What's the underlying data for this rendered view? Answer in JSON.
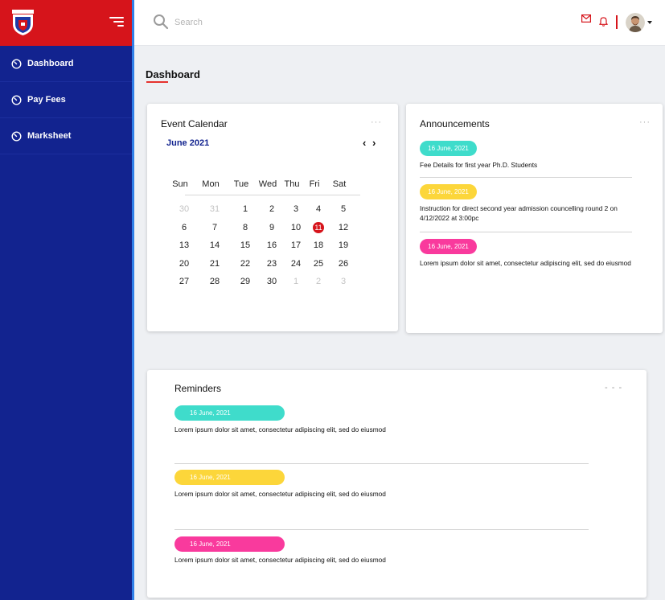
{
  "sidebar": {
    "items": [
      {
        "label": "Dashboard"
      },
      {
        "label": "Pay Fees"
      },
      {
        "label": "Marksheet"
      }
    ]
  },
  "topbar": {
    "search_placeholder": "Search"
  },
  "page": {
    "title": "Dashboard"
  },
  "calendar": {
    "title": "Event Calendar",
    "month_label": "June 2021",
    "prev": "‹",
    "next": "›",
    "weekdays": [
      "Sun",
      "Mon",
      "Tue",
      "Wed",
      "Thu",
      "Fri",
      "Sat"
    ],
    "weeks": [
      [
        "30",
        "31",
        "1",
        "2",
        "3",
        "4",
        "5"
      ],
      [
        "6",
        "7",
        "8",
        "9",
        "10",
        "11",
        "12"
      ],
      [
        "13",
        "14",
        "15",
        "16",
        "17",
        "18",
        "19"
      ],
      [
        "20",
        "21",
        "22",
        "23",
        "24",
        "25",
        "26"
      ],
      [
        "27",
        "28",
        "29",
        "30",
        "1",
        "2",
        "3"
      ]
    ],
    "selected_day": "11",
    "menu": "···"
  },
  "announcements": {
    "title": "Announcements",
    "menu": "···",
    "items": [
      {
        "date": "16 June, 2021",
        "text": "Fee Details for first year Ph.D. Students",
        "color": "#3fdccb"
      },
      {
        "date": "16 June, 2021",
        "text": "Instruction for direct second year admission councelling round 2 on 4/12/2022 at 3:00pc",
        "color": "#fcd63a"
      },
      {
        "date": "16 June, 2021",
        "text": "Lorem ipsum dolor sit amet, consectetur adipiscing elit, sed do eiusmod",
        "color": "#f93a9d"
      }
    ]
  },
  "reminders": {
    "title": "Reminders",
    "menu": "- - -",
    "items": [
      {
        "date": "16 June, 2021",
        "text": "Lorem ipsum dolor sit amet, consectetur adipiscing elit, sed do eiusmod",
        "color": "#3fdccb"
      },
      {
        "date": "16 June, 2021",
        "text": "Lorem ipsum dolor sit amet, consectetur adipiscing elit, sed do eiusmod",
        "color": "#fcd63a"
      },
      {
        "date": "16 June, 2021",
        "text": "Lorem ipsum dolor sit amet, consectetur adipiscing elit, sed do eiusmod",
        "color": "#f93a9d"
      }
    ]
  },
  "colors": {
    "brand_red": "#d6141b",
    "sidebar_blue": "#12238f",
    "accent_teal": "#3fdccb",
    "accent_yellow": "#fcd63a",
    "accent_pink": "#f93a9d"
  }
}
